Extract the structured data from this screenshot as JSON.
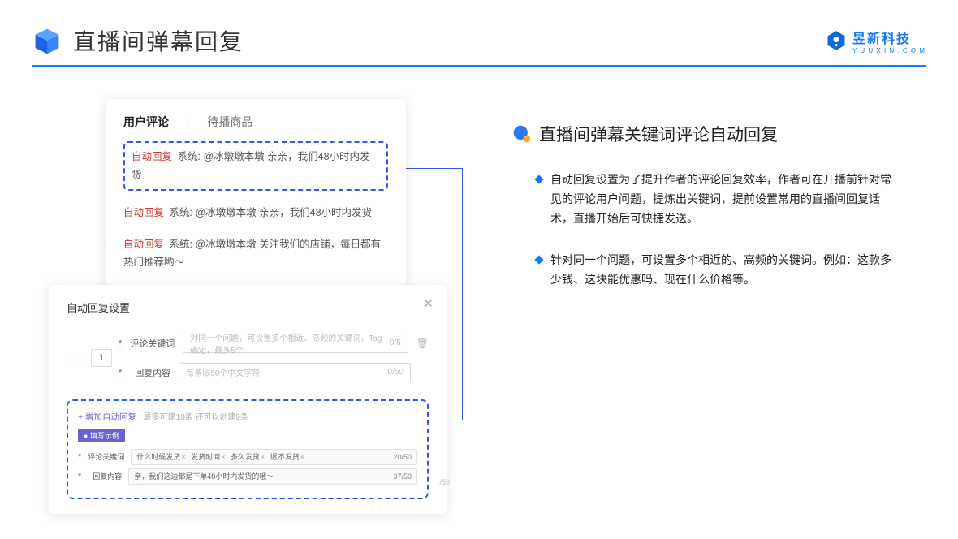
{
  "header": {
    "title": "直播间弹幕回复",
    "logo_cn": "昱新科技",
    "logo_en": "Y U U X I N . C O M"
  },
  "comments_panel": {
    "tabs": {
      "active": "用户评论",
      "inactive": "待播商品"
    },
    "items": [
      {
        "tag": "自动回复",
        "prefix": "系统:",
        "text": "@冰墩墩本墩 亲亲，我们48小时内发货",
        "highlight": true
      },
      {
        "tag": "自动回复",
        "prefix": "系统:",
        "text": "@冰墩墩本墩 亲亲，我们48小时内发货",
        "highlight": false
      },
      {
        "tag": "自动回复",
        "prefix": "系统:",
        "text": "@冰墩墩本墩 关注我们的店铺，每日都有热门推荐哟～",
        "highlight": false
      }
    ]
  },
  "settings_panel": {
    "title": "自动回复设置",
    "index": "1",
    "field_keyword_label": "评论关键词",
    "field_keyword_placeholder": "对同一个问题，可设置多个相近、高频的关键词，Tag确定，最多5个",
    "field_keyword_count": "0/5",
    "field_reply_label": "回复内容",
    "field_reply_placeholder": "每条限50个中文字符",
    "field_reply_count": "0/50",
    "add_link": "+ 增加自动回复",
    "add_limit": "最多可建10条 还可以创建9条",
    "example_tag": "● 填写示例",
    "ex_keyword_label": "评论关键词",
    "ex_keywords": [
      "什么时候发货",
      "发货时间",
      "多久发货",
      "迟不发货"
    ],
    "ex_keyword_count": "20/50",
    "ex_reply_label": "回复内容",
    "ex_reply_value": "亲，我们这边都是下单48小时内发货的哦～",
    "ex_reply_count": "37/50",
    "outer_count": "/50"
  },
  "right": {
    "section_title": "直播间弹幕关键词评论自动回复",
    "bullets": [
      "自动回复设置为了提升作者的评论回复效率，作者可在开播前针对常见的评论用户问题，提炼出关键词，提前设置常用的直播间回复话术，直播开始后可快捷发送。",
      "针对同一个问题，可设置多个相近的、高频的关键词。例如：这款多少钱、这块能优惠吗、现在什么价格等。"
    ]
  }
}
